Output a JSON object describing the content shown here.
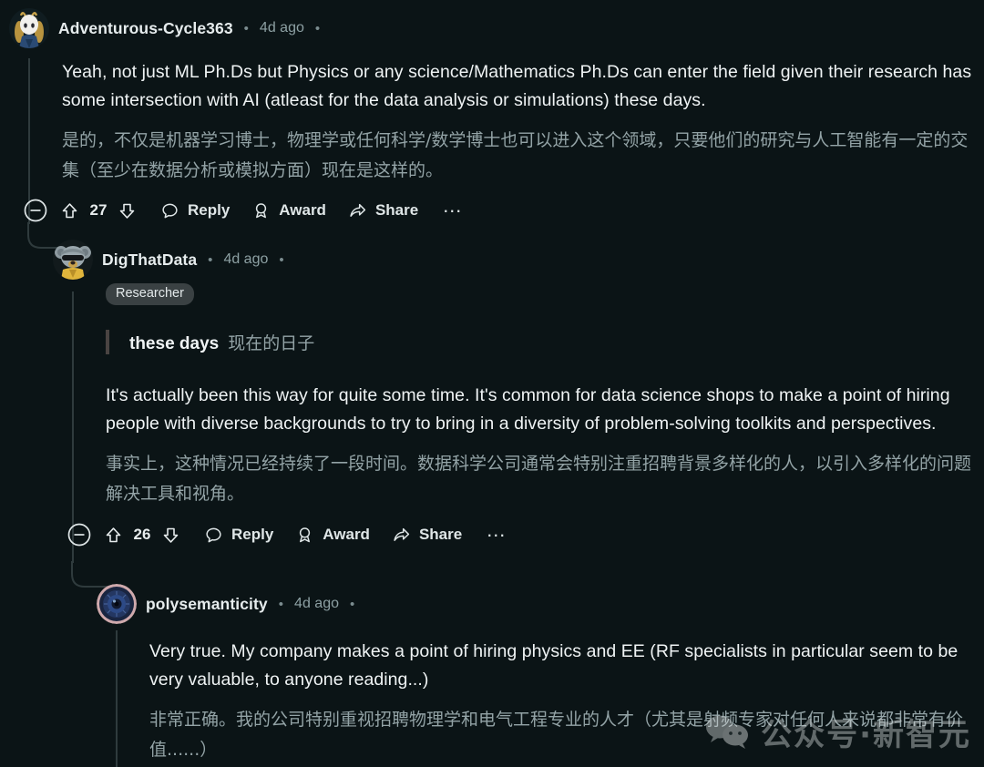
{
  "platform": "reddit-comment-thread",
  "theme": {
    "background": "#0b1416",
    "text_primary": "#eff3f4",
    "text_secondary": "#93a3a6",
    "thread_line": "#2f3b3d",
    "flair_bg": "#3a4143",
    "quote_border": "#4a4442"
  },
  "comments": [
    {
      "id": "comment-1",
      "depth": 0,
      "username": "Adventurous-Cycle363",
      "age": "4d ago",
      "separator": "•",
      "avatar_icon": "avatar-anime-girl",
      "flair": null,
      "quote": null,
      "body_en": "Yeah, not just ML Ph.Ds but Physics or any science/Mathematics Ph.Ds can enter the field given their research has some intersection with AI (atleast for the data analysis or simulations) these days.",
      "body_zh": "是的，不仅是机器学习博士，物理学或任何科学/数学博士也可以进入这个领域，只要他们的研究与人工智能有一定的交集（至少在数据分析或模拟方面）现在是这样的。",
      "votes": "27",
      "actions": {
        "reply": "Reply",
        "award": "Award",
        "share": "Share",
        "more": "…"
      }
    },
    {
      "id": "comment-2",
      "depth": 1,
      "username": "DigThatData",
      "age": "4d ago",
      "separator": "•",
      "avatar_icon": "avatar-koala-sunglasses",
      "flair": "Researcher",
      "quote": {
        "en": "these days",
        "zh": "现在的日子"
      },
      "body_en": "It's actually been this way for quite some time. It's common for data science shops to make a point of hiring people with diverse backgrounds to try to bring in a diversity of problem-solving toolkits and perspectives.",
      "body_zh": "事实上，这种情况已经持续了一段时间。数据科学公司通常会特别注重招聘背景多样化的人，以引入多样化的问题解决工具和视角。",
      "votes": "26",
      "actions": {
        "reply": "Reply",
        "award": "Award",
        "share": "Share",
        "more": "…"
      }
    },
    {
      "id": "comment-3",
      "depth": 2,
      "username": "polysemanticity",
      "age": "4d ago",
      "separator": "•",
      "avatar_icon": "avatar-blue-eye",
      "flair": null,
      "quote": null,
      "body_en": "Very true. My company makes a point of hiring physics and EE (RF specialists in particular seem to be very valuable, to anyone reading...)",
      "body_zh": "非常正确。我的公司特别重视招聘物理学和电气工程专业的人才（尤其是射频专家对任何人来说都非常有价值......）",
      "votes": null,
      "actions": null
    }
  ],
  "watermark": {
    "text": "公众号·新智元",
    "icon": "wechat-icon"
  }
}
